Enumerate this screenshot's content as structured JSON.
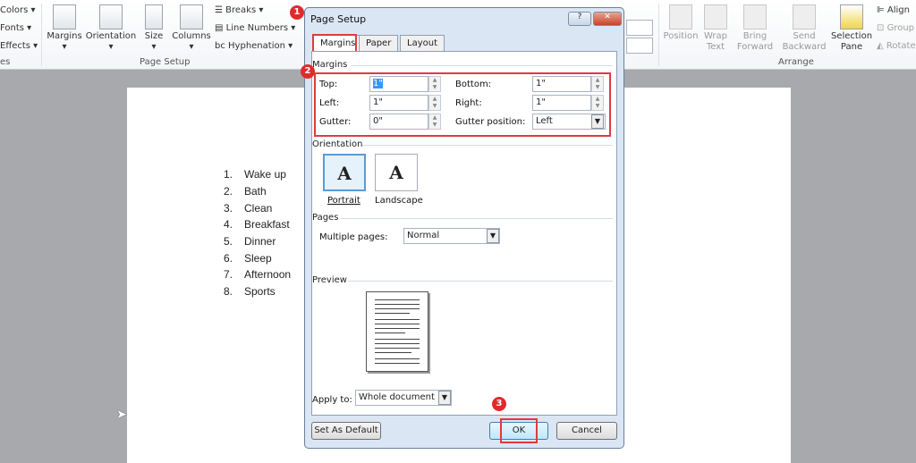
{
  "ribbon": {
    "themes": [
      "Colors",
      "Fonts",
      "Effects"
    ],
    "themes_group": "es",
    "page_setup": {
      "buttons": [
        "Margins",
        "Orientation",
        "Size",
        "Columns"
      ],
      "small": [
        "Breaks",
        "Line Numbers",
        "Hyphenation"
      ],
      "group": "Page Setup"
    },
    "arrange": {
      "buttons": [
        {
          "l1": "Position",
          "l2": ""
        },
        {
          "l1": "Wrap",
          "l2": "Text"
        },
        {
          "l1": "Bring",
          "l2": "Forward"
        },
        {
          "l1": "Send",
          "l2": "Backward"
        },
        {
          "l1": "Selection",
          "l2": "Pane"
        }
      ],
      "small": [
        "Align",
        "Group",
        "Rotate"
      ],
      "group": "Arrange"
    }
  },
  "document": {
    "list": [
      {
        "n": "1.",
        "t": "Wake up"
      },
      {
        "n": "2.",
        "t": "Bath"
      },
      {
        "n": "3.",
        "t": "Clean"
      },
      {
        "n": "4.",
        "t": "Breakfast"
      },
      {
        "n": "5.",
        "t": "Dinner"
      },
      {
        "n": "6.",
        "t": "Sleep"
      },
      {
        "n": "7.",
        "t": "Afternoon"
      },
      {
        "n": "8.",
        "t": "Sports"
      }
    ]
  },
  "dialog": {
    "title": "Page Setup",
    "help": "?",
    "close": "✕",
    "tabs": [
      "Margins",
      "Paper",
      "Layout"
    ],
    "margins_section": "Margins",
    "fields": {
      "top_label": "Top:",
      "top": "1\"",
      "bottom_label": "Bottom:",
      "bottom": "1\"",
      "left_label": "Left:",
      "left": "1\"",
      "right_label": "Right:",
      "right": "1\"",
      "gutter_label": "Gutter:",
      "gutter": "0\"",
      "gutter_pos_label": "Gutter position:",
      "gutter_pos": "Left"
    },
    "orientation_section": "Orientation",
    "portrait": "Portrait",
    "landscape": "Landscape",
    "pages_section": "Pages",
    "multiple_pages_label": "Multiple pages:",
    "multiple_pages": "Normal",
    "preview_section": "Preview",
    "apply_to_label": "Apply to:",
    "apply_to": "Whole document",
    "set_default": "Set As Default",
    "ok": "OK",
    "cancel": "Cancel"
  },
  "annotations": [
    "1",
    "2",
    "3"
  ],
  "colors": {
    "highlight": "#e03b3b"
  }
}
